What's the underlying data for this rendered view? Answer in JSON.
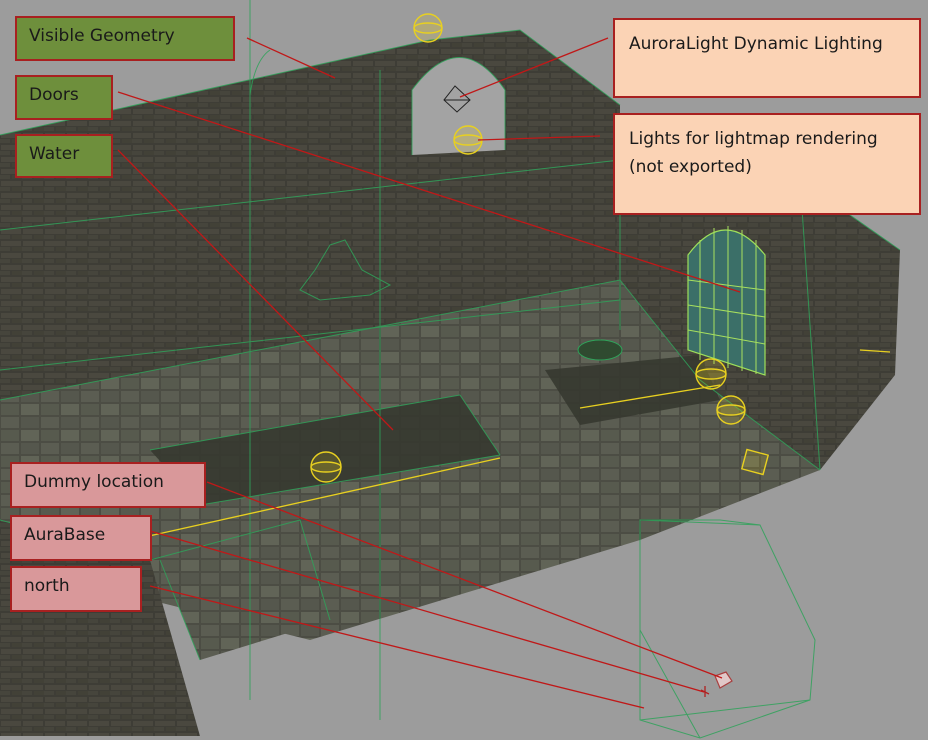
{
  "labels": {
    "visible_geometry": "Visible Geometry",
    "doors": "Doors",
    "water": "Water",
    "auroralight": "AuroraLight Dynamic Lighting",
    "lightmap_line1": "Lights for lightmap rendering",
    "lightmap_line2": "(not exported)",
    "dummy_location": "Dummy location",
    "aurabase": "AuraBase",
    "north": "north"
  },
  "colors": {
    "label_green": "#6e8f3c",
    "label_pink": "#d9989a",
    "label_peach": "#fbd3b5",
    "callout_line": "#c01818",
    "wireframe": "#2fa35a",
    "light_gizmo": "#e8d020"
  },
  "icons": [
    "light-sphere-icon",
    "dummy-cube-icon",
    "aurabase-marker-icon",
    "door-mesh-icon"
  ]
}
